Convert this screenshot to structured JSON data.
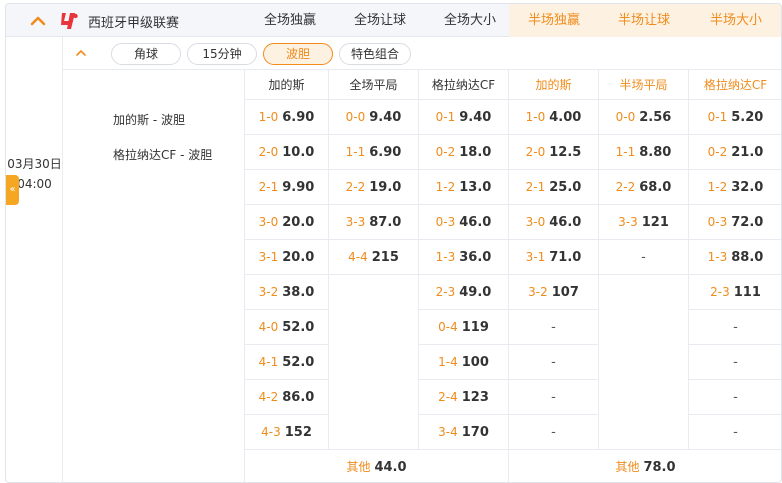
{
  "header": {
    "league": "西班牙甲级联赛",
    "columns": [
      "全场独赢",
      "全场让球",
      "全场大小",
      "半场独赢",
      "半场让球",
      "半场大小"
    ]
  },
  "match": {
    "date": "03月30日",
    "time": "04:00"
  },
  "teams": [
    "加的斯 - 波胆",
    "格拉纳达CF - 波胆"
  ],
  "filters": [
    {
      "label": "角球",
      "active": false
    },
    {
      "label": "15分钟",
      "active": false
    },
    {
      "label": "波胆",
      "active": true
    },
    {
      "label": "特色组合",
      "active": false
    }
  ],
  "grid_headers": [
    "加的斯",
    "全场平局",
    "格拉纳达CF",
    "加的斯",
    "半场平局",
    "格拉纳达CF"
  ],
  "grid_rows": [
    [
      [
        "1-0",
        "6.90"
      ],
      [
        "0-0",
        "9.40"
      ],
      [
        "0-1",
        "9.40"
      ],
      [
        "1-0",
        "4.00"
      ],
      [
        "0-0",
        "2.56"
      ],
      [
        "0-1",
        "5.20"
      ]
    ],
    [
      [
        "2-0",
        "10.0"
      ],
      [
        "1-1",
        "6.90"
      ],
      [
        "0-2",
        "18.0"
      ],
      [
        "2-0",
        "12.5"
      ],
      [
        "1-1",
        "8.80"
      ],
      [
        "0-2",
        "21.0"
      ]
    ],
    [
      [
        "2-1",
        "9.90"
      ],
      [
        "2-2",
        "19.0"
      ],
      [
        "1-2",
        "13.0"
      ],
      [
        "2-1",
        "25.0"
      ],
      [
        "2-2",
        "68.0"
      ],
      [
        "1-2",
        "32.0"
      ]
    ],
    [
      [
        "3-0",
        "20.0"
      ],
      [
        "3-3",
        "87.0"
      ],
      [
        "0-3",
        "46.0"
      ],
      [
        "3-0",
        "46.0"
      ],
      [
        "3-3",
        "121"
      ],
      [
        "0-3",
        "72.0"
      ]
    ],
    [
      [
        "3-1",
        "20.0"
      ],
      [
        "4-4",
        "215"
      ],
      [
        "1-3",
        "36.0"
      ],
      [
        "3-1",
        "71.0"
      ],
      [
        "",
        "-"
      ],
      [
        "1-3",
        "88.0"
      ]
    ],
    [
      [
        "3-2",
        "38.0"
      ],
      null,
      [
        "2-3",
        "49.0"
      ],
      [
        "3-2",
        "107"
      ],
      null,
      [
        "2-3",
        "111"
      ]
    ],
    [
      [
        "4-0",
        "52.0"
      ],
      null,
      [
        "0-4",
        "119"
      ],
      [
        "",
        "-"
      ],
      null,
      [
        "",
        "-"
      ]
    ],
    [
      [
        "4-1",
        "52.0"
      ],
      null,
      [
        "1-4",
        "100"
      ],
      [
        "",
        "-"
      ],
      null,
      [
        "",
        "-"
      ]
    ],
    [
      [
        "4-2",
        "86.0"
      ],
      null,
      [
        "2-4",
        "123"
      ],
      [
        "",
        "-"
      ],
      null,
      [
        "",
        "-"
      ]
    ],
    [
      [
        "4-3",
        "152"
      ],
      null,
      [
        "3-4",
        "170"
      ],
      [
        "",
        "-"
      ],
      null,
      [
        "",
        "-"
      ]
    ]
  ],
  "other_full": {
    "label": "其他",
    "odds": "44.0"
  },
  "other_half": {
    "label": "其他",
    "odds": "78.0"
  },
  "colors": {
    "accent": "#f08c1c",
    "handle": "#f5a623",
    "half_bg": "#fdf1e2"
  }
}
